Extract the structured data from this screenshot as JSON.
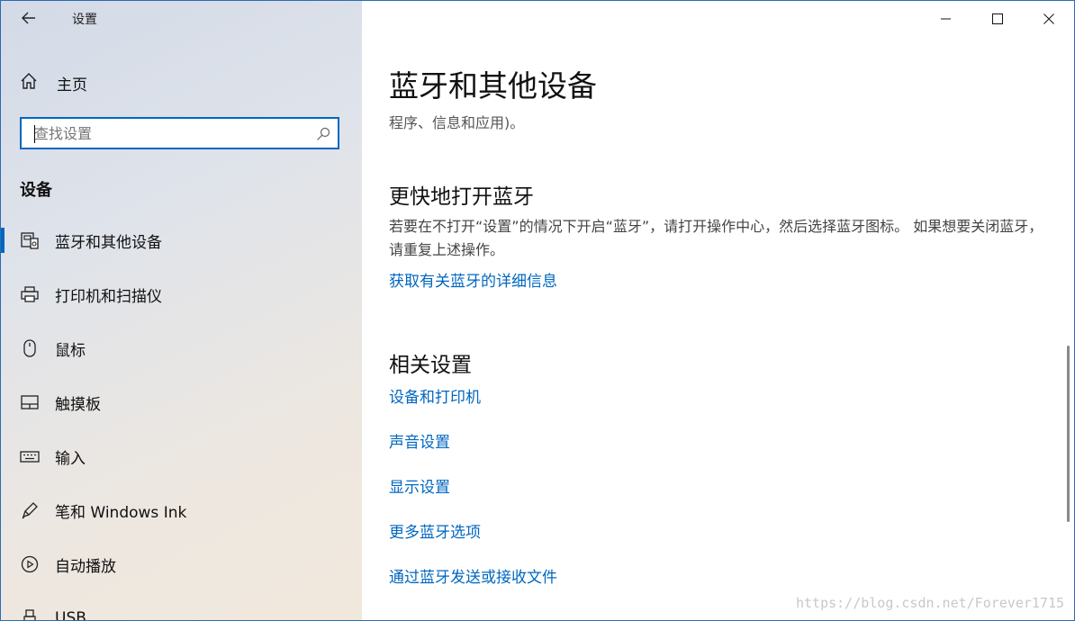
{
  "app": {
    "title": "设置",
    "back_icon": "back-arrow-icon"
  },
  "sidebar": {
    "home_label": "主页",
    "search_placeholder": "查找设置",
    "section_title": "设备",
    "items": [
      {
        "label": "蓝牙和其他设备",
        "icon": "bluetooth-devices-icon",
        "active": true
      },
      {
        "label": "打印机和扫描仪",
        "icon": "printer-icon",
        "active": false
      },
      {
        "label": "鼠标",
        "icon": "mouse-icon",
        "active": false
      },
      {
        "label": "触摸板",
        "icon": "touchpad-icon",
        "active": false
      },
      {
        "label": "输入",
        "icon": "keyboard-icon",
        "active": false
      },
      {
        "label": "笔和 Windows Ink",
        "icon": "pen-icon",
        "active": false
      },
      {
        "label": "自动播放",
        "icon": "autoplay-icon",
        "active": false
      },
      {
        "label": "USB",
        "icon": "usb-icon",
        "active": false
      }
    ]
  },
  "window_controls": [
    "minimize-icon",
    "maximize-icon",
    "close-icon"
  ],
  "main": {
    "title": "蓝牙和其他设备",
    "subtext": "程序、信息和应用)。",
    "quick_bluetooth": {
      "heading": "更快地打开蓝牙",
      "description": "若要在不打开“设置”的情况下开启“蓝牙”，请打开操作中心，然后选择蓝牙图标。 如果想要关闭蓝牙，请重复上述操作。",
      "link": "获取有关蓝牙的详细信息"
    },
    "related": {
      "heading": "相关设置",
      "links": [
        "设备和打印机",
        "声音设置",
        "显示设置",
        "更多蓝牙选项",
        "通过蓝牙发送或接收文件"
      ]
    }
  },
  "watermark": "https://blog.csdn.net/Forever1715",
  "colors": {
    "accent": "#0067c0",
    "link": "#0067c0"
  }
}
